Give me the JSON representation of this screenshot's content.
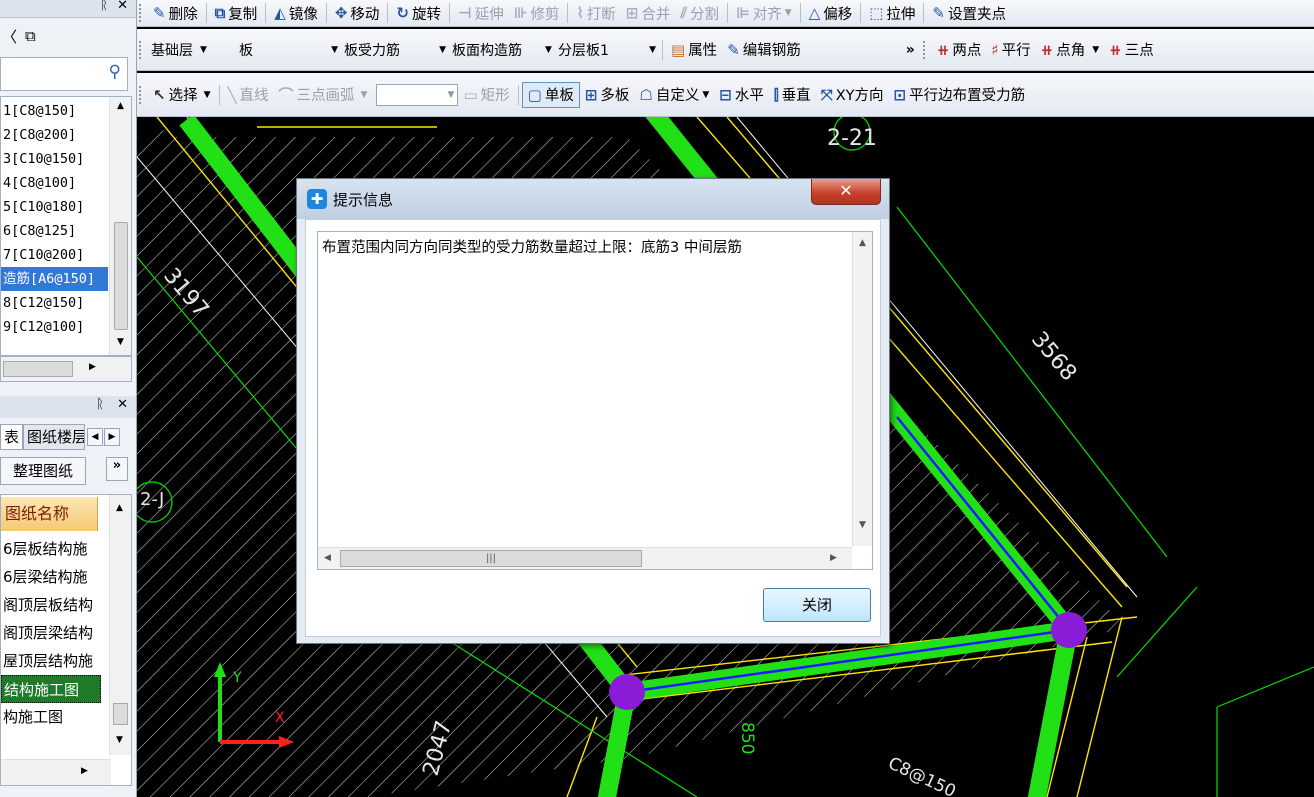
{
  "toolbar_edit": [
    {
      "label": "删除",
      "icon": "eraser-icon",
      "glyph": "✎",
      "dis": false
    },
    {
      "label": "复制",
      "icon": "copy-icon",
      "glyph": "⧉",
      "dis": false
    },
    {
      "label": "镜像",
      "icon": "mirror-icon",
      "glyph": "◭",
      "dis": false
    },
    {
      "label": "移动",
      "icon": "move-icon",
      "glyph": "✥",
      "dis": false
    },
    {
      "label": "旋转",
      "icon": "rotate-icon",
      "glyph": "↻",
      "dis": false
    },
    {
      "label": "延伸",
      "icon": "extend-icon",
      "glyph": "⊣",
      "dis": true
    },
    {
      "label": "修剪",
      "icon": "trim-icon",
      "glyph": "⊪",
      "dis": true
    },
    {
      "label": "打断",
      "icon": "break-icon",
      "glyph": "⌇",
      "dis": true
    },
    {
      "label": "合并",
      "icon": "merge-icon",
      "glyph": "⊞",
      "dis": true
    },
    {
      "label": "分割",
      "icon": "split-icon",
      "glyph": "⫽",
      "dis": true
    },
    {
      "label": "对齐",
      "icon": "align-icon",
      "glyph": "⊫",
      "dis": true,
      "dropdown": true
    },
    {
      "label": "偏移",
      "icon": "offset-icon",
      "glyph": "△",
      "dis": false
    },
    {
      "label": "拉伸",
      "icon": "stretch-icon",
      "glyph": "⬚",
      "dis": false
    },
    {
      "label": "设置夹点",
      "icon": "grip-point-icon",
      "glyph": "✎",
      "dis": false
    }
  ],
  "toolbar_layer": {
    "layer": "基础层",
    "element": "板",
    "rebar_type": "板受力筋",
    "construct": "板面构造筋",
    "sublayer": "分层板1",
    "props": "属性",
    "edit_rebar": "编辑钢筋",
    "more": "»",
    "draw": [
      "两点",
      "平行",
      "点角",
      "三点"
    ]
  },
  "toolbar_draw": {
    "select": "选择",
    "line": "直线",
    "arc": "三点画弧",
    "rect": "矩形",
    "modes": [
      {
        "label": "单板",
        "icon": "single-slab-icon",
        "active": true
      },
      {
        "label": "多板",
        "icon": "multi-slab-icon",
        "active": false
      },
      {
        "label": "自定义",
        "icon": "custom-icon",
        "active": false
      },
      {
        "label": "水平",
        "icon": "horizontal-icon",
        "active": false
      },
      {
        "label": "垂直",
        "icon": "vertical-icon",
        "active": false
      },
      {
        "label": "XY方向",
        "icon": "xy-direction-icon",
        "active": false
      },
      {
        "label": "平行边布置受力筋",
        "icon": "parallel-edge-icon",
        "active": false
      }
    ]
  },
  "left_panel": {
    "rebar_list": [
      "1[C8@150]",
      "2[C8@200]",
      "3[C10@150]",
      "4[C8@100]",
      "5[C10@180]",
      "6[C8@125]",
      "7[C10@200]",
      "造筋[A6@150]",
      "8[C12@150]",
      "9[C12@100]"
    ],
    "selected_index": 7,
    "tabs": [
      "表",
      "图纸楼层"
    ],
    "organize_btn": "整理图纸",
    "drawings_header": "图纸名称",
    "drawings": [
      "6层板结构施",
      "6层梁结构施",
      "阁顶层板结构",
      "阁顶层梁结构",
      "屋顶层结构施",
      "结构施工图",
      "构施工图"
    ],
    "drawings_selected": 5
  },
  "cad": {
    "labels": [
      "2-21",
      "3197",
      "3568",
      "2-J",
      "2047",
      "C8@150",
      "850"
    ],
    "axis_y": "Y",
    "axis_x": "X"
  },
  "dialog": {
    "title": "提示信息",
    "message": "布置范围内同方向同类型的受力筋数量超过上限：底筋3  中间层筋",
    "close_label": "关闭",
    "close_glyph": "✕"
  }
}
